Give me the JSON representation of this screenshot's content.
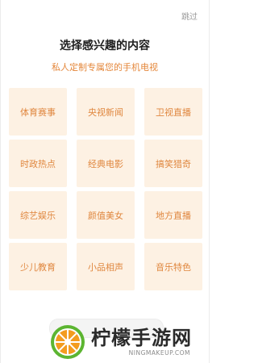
{
  "header": {
    "skip_label": "跳过",
    "title": "选择感兴趣的内容",
    "subtitle": "私人定制专属您的手机电视"
  },
  "categories": [
    {
      "label": "体育赛事"
    },
    {
      "label": "央视新闻"
    },
    {
      "label": "卫视直播"
    },
    {
      "label": "时政热点"
    },
    {
      "label": "经典电影"
    },
    {
      "label": "搞笑猎奇"
    },
    {
      "label": "综艺娱乐"
    },
    {
      "label": "颜值美女"
    },
    {
      "label": "地方直播"
    },
    {
      "label": "少儿教育"
    },
    {
      "label": "小品相声"
    },
    {
      "label": "音乐特色"
    }
  ],
  "watermark": {
    "brand": "柠檬手游网",
    "url": "NINGMAKEUP.COM"
  },
  "colors": {
    "accent": "#e4873b",
    "tile_background": "#fdf1e3",
    "title": "#1e1e1e",
    "skip": "#9a9a9a",
    "logo_orange": "#f39c1f",
    "logo_green": "#5cb531"
  }
}
